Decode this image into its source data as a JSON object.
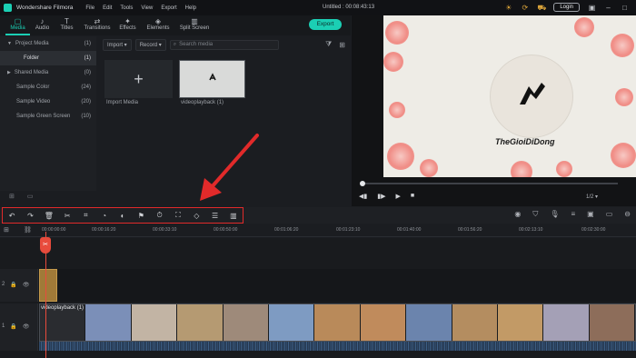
{
  "app": {
    "name": "Wondershare Filmora",
    "doc_title": "Untitled : 00:08:43:13",
    "login_label": "Login"
  },
  "menu": [
    "File",
    "Edit",
    "Tools",
    "View",
    "Export",
    "Help"
  ],
  "tabs": [
    {
      "label": "Media",
      "icon": "folder-icon",
      "glyph": "▢"
    },
    {
      "label": "Audio",
      "icon": "music-icon",
      "glyph": "♪"
    },
    {
      "label": "Titles",
      "icon": "text-icon",
      "glyph": "T"
    },
    {
      "label": "Transitions",
      "icon": "transition-icon",
      "glyph": "⇄"
    },
    {
      "label": "Effects",
      "icon": "sparkle-icon",
      "glyph": "✦"
    },
    {
      "label": "Elements",
      "icon": "shapes-icon",
      "glyph": "◈"
    },
    {
      "label": "Split Screen",
      "icon": "split-icon",
      "glyph": "▥"
    }
  ],
  "export_label": "Export",
  "tree": [
    {
      "label": "Project Media",
      "count": "(1)",
      "caret": "▼"
    },
    {
      "label": "Folder",
      "count": "(1)"
    },
    {
      "label": "Shared Media",
      "count": "(0)",
      "caret": "▶"
    },
    {
      "label": "Sample Color",
      "count": "(24)"
    },
    {
      "label": "Sample Video",
      "count": "(20)"
    },
    {
      "label": "Sample Green Screen",
      "count": "(10)"
    }
  ],
  "media_bar": {
    "import_label": "Import",
    "record_label": "Record",
    "search_placeholder": "Search media"
  },
  "media_items": {
    "import_label": "Import Media",
    "video_label": "videoplayback (1)"
  },
  "preview": {
    "brand_text": "TheGioiDiDong",
    "page_label": "1/2"
  },
  "ruler": [
    "00:00:00:00",
    "00:00:16:20",
    "00:00:33:10",
    "00:00:50:00",
    "00:01:06:20",
    "00:01:23:10",
    "00:01:40:00",
    "00:01:56:20",
    "00:02:13:10",
    "00:02:30:00"
  ],
  "clip": {
    "label": "videoplayback (1)"
  },
  "tracks": {
    "track2": "2",
    "track1": "1"
  },
  "edit_tools": [
    "undo-icon",
    "redo-icon",
    "delete-icon",
    "cut-icon",
    "crop-icon",
    "speed-icon",
    "color-icon",
    "marker-icon",
    "timer-icon",
    "fit-icon",
    "keyframe-icon",
    "adjust-icon",
    "audio-icon"
  ],
  "colors": {
    "accent": "#1bcfb4",
    "highlight": "#e12a2a",
    "playhead": "#e84b3c"
  }
}
